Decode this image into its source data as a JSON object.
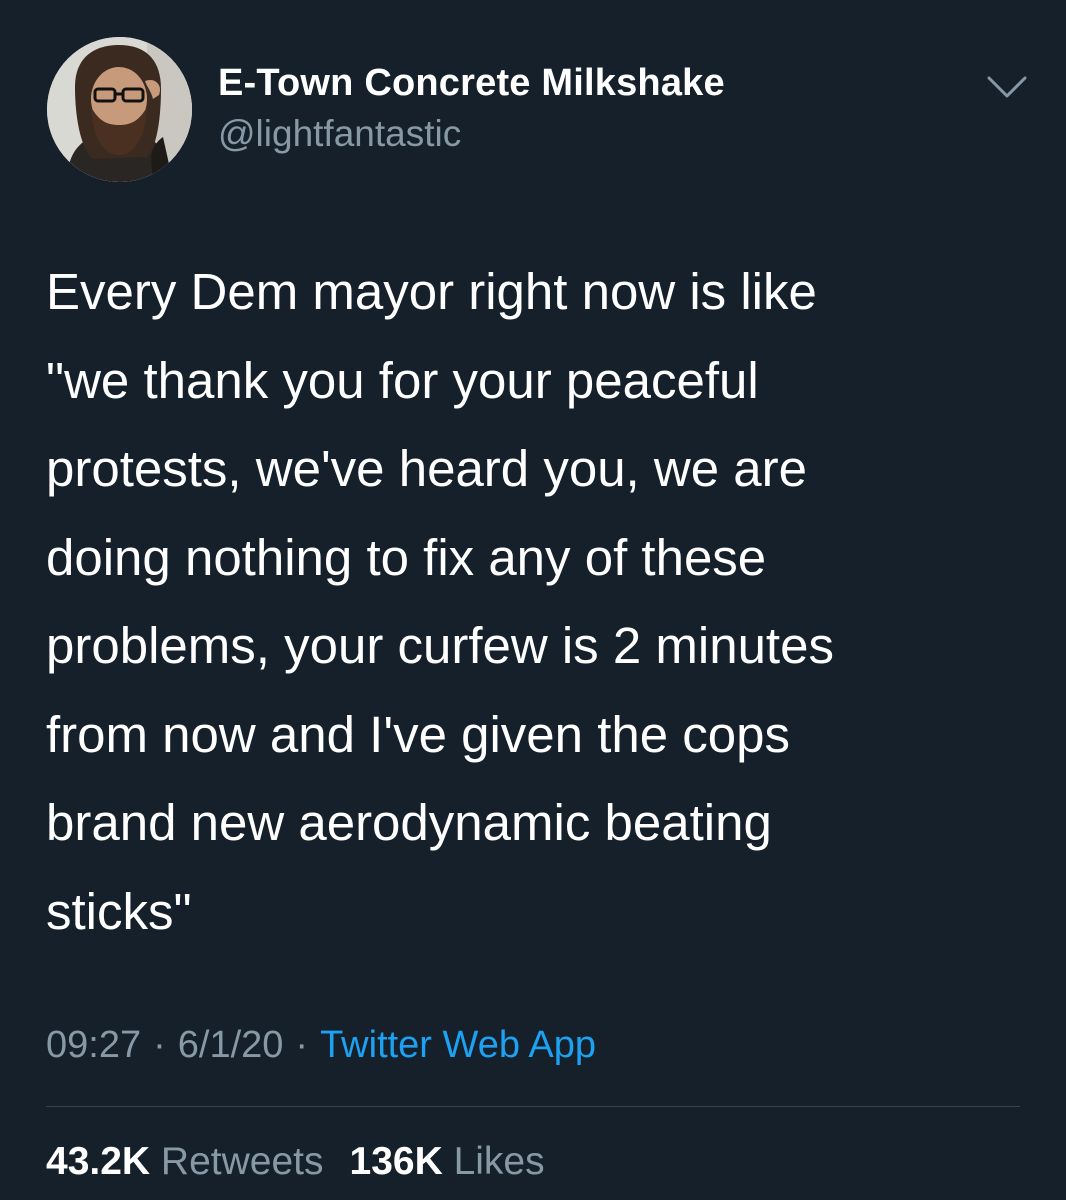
{
  "tweet": {
    "author": {
      "display_name": "E-Town Concrete Milkshake",
      "handle": "@lightfantastic"
    },
    "menu_icon": "chevron-down-icon",
    "text": "Every Dem mayor right now is like\n\"we thank you for your peaceful\nprotests, we've heard you, we are\ndoing nothing to fix any of these\nproblems, your curfew is 2 minutes\nfrom now and I've given the cops\nbrand new aerodynamic beating\nsticks\"",
    "time": "09:27",
    "date": "6/1/20",
    "separator": "·",
    "source": "Twitter Web App",
    "stats": {
      "retweets_count": "43.2K",
      "retweets_label": "Retweets",
      "likes_count": "136K",
      "likes_label": "Likes"
    },
    "colors": {
      "background": "#15202b",
      "text_primary": "#ffffff",
      "text_secondary": "#8899a6",
      "link": "#1da1f2",
      "divider": "#38444d"
    }
  }
}
